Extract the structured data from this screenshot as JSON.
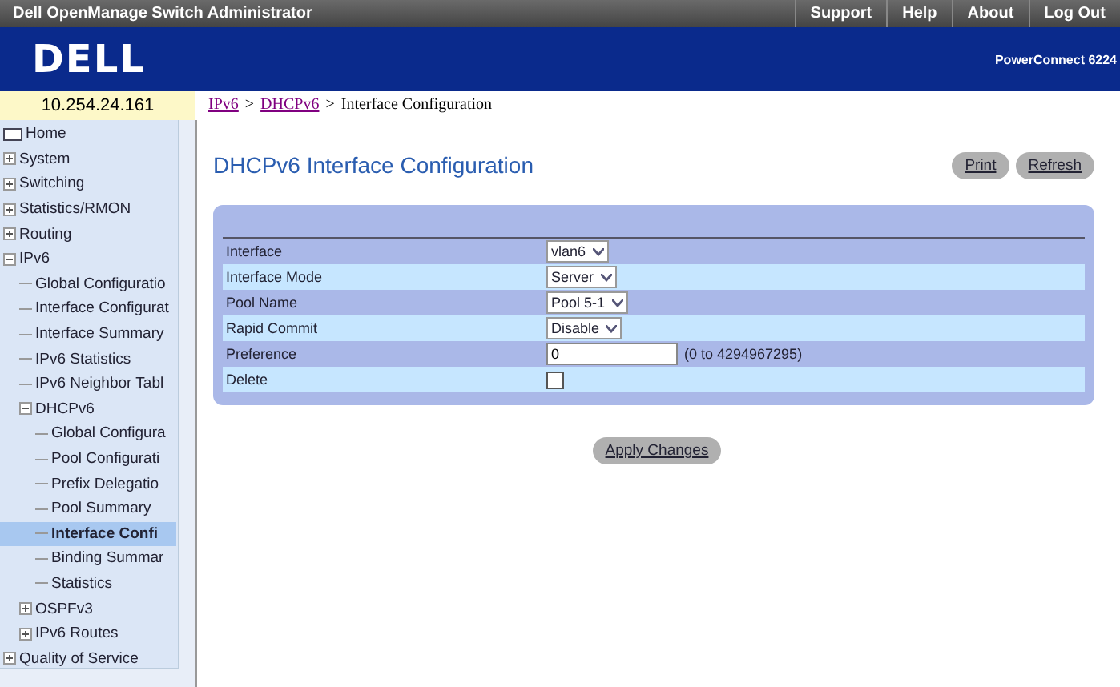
{
  "window": {
    "title": "Dell OpenManage Switch Administrator"
  },
  "top_links": [
    "Support",
    "Help",
    "About",
    "Log Out"
  ],
  "banner": {
    "logo": "DELL",
    "product": "PowerConnect 6224"
  },
  "address": "10.254.24.161",
  "breadcrumb_separator": ">",
  "breadcrumb": [
    {
      "label": "IPv6",
      "link": true
    },
    {
      "label": "DHCPv6",
      "link": true
    },
    {
      "label": "Interface Configuration",
      "link": false
    }
  ],
  "sidebar": {
    "items": [
      {
        "label": "Home",
        "kind": "home",
        "selected": false
      },
      {
        "label": "System",
        "kind": "folder",
        "expanded": false,
        "selected": false
      },
      {
        "label": "Switching",
        "kind": "folder",
        "expanded": false,
        "selected": false
      },
      {
        "label": "Statistics/RMON",
        "kind": "folder",
        "expanded": false,
        "selected": false
      },
      {
        "label": "Routing",
        "kind": "folder",
        "expanded": false,
        "selected": false
      },
      {
        "label": "IPv6",
        "kind": "folder",
        "expanded": true,
        "selected": false,
        "children": [
          {
            "label": "Global Configuratio",
            "kind": "page",
            "selected": false
          },
          {
            "label": "Interface Configurat",
            "kind": "page",
            "selected": false
          },
          {
            "label": "Interface Summary",
            "kind": "page",
            "selected": false
          },
          {
            "label": "IPv6 Statistics",
            "kind": "page",
            "selected": false
          },
          {
            "label": "IPv6 Neighbor Tabl",
            "kind": "page",
            "selected": false
          },
          {
            "label": "DHCPv6",
            "kind": "folder",
            "expanded": true,
            "selected": false,
            "children": [
              {
                "label": "Global Configura",
                "kind": "page",
                "selected": false
              },
              {
                "label": "Pool Configurati",
                "kind": "page",
                "selected": false
              },
              {
                "label": "Prefix Delegatio",
                "kind": "page",
                "selected": false
              },
              {
                "label": "Pool Summary",
                "kind": "page",
                "selected": false
              },
              {
                "label": "Interface Confi",
                "kind": "page",
                "selected": true
              },
              {
                "label": "Binding Summar",
                "kind": "page",
                "selected": false
              },
              {
                "label": "Statistics",
                "kind": "page",
                "selected": false
              }
            ]
          },
          {
            "label": "OSPFv3",
            "kind": "folder",
            "expanded": false,
            "selected": false
          },
          {
            "label": "IPv6 Routes",
            "kind": "folder",
            "expanded": false,
            "selected": false
          }
        ]
      },
      {
        "label": "Quality of Service",
        "kind": "folder",
        "expanded": false,
        "selected": false
      }
    ]
  },
  "page": {
    "title": "DHCPv6 Interface Configuration",
    "buttons": [
      "Print",
      "Refresh"
    ],
    "fields": [
      {
        "label": "Interface",
        "kind": "select",
        "value": "vlan6"
      },
      {
        "label": "Interface Mode",
        "kind": "select",
        "value": "Server"
      },
      {
        "label": "Pool Name",
        "kind": "select",
        "value": "Pool 5-1"
      },
      {
        "label": "Rapid Commit",
        "kind": "select",
        "value": "Disable"
      },
      {
        "label": "Preference",
        "kind": "text",
        "value": "0",
        "hint": "(0 to 4294967295)"
      },
      {
        "label": "Delete",
        "kind": "checkbox",
        "checked": false
      }
    ],
    "apply": "Apply Changes"
  }
}
